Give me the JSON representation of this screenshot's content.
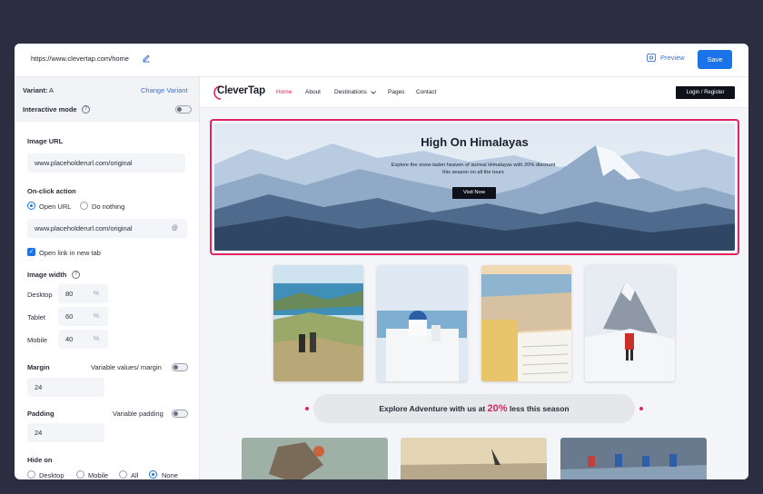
{
  "topbar": {
    "url": "https://www.clevertap.com/home",
    "preview_label": "Preview",
    "save_label": "Save"
  },
  "sidebar": {
    "variant_label": "Variant:",
    "variant_value": "A",
    "change_variant": "Change Variant",
    "interactive_mode": "Interactive mode",
    "image_url_label": "Image URL",
    "image_url_value": "www.placeholderurl.com/original",
    "onclick_label": "On-click action",
    "open_url": "Open URL",
    "do_nothing": "Do nothing",
    "onclick_url_value": "www.placeholderurl.com/original",
    "open_new_tab": "Open link in new tab",
    "image_width_label": "Image width",
    "desktop": "Desktop",
    "desktop_value": "80",
    "tablet": "Tablet",
    "tablet_value": "60",
    "mobile": "Mobile",
    "mobile_value": "40",
    "percent": "%",
    "margin_label": "Margin",
    "variable_margin": "Variable values/ margin",
    "margin_value": "24",
    "padding_label": "Padding",
    "variable_padding": "Variable padding",
    "padding_value": "24",
    "hide_on_label": "Hide on",
    "hide_options": [
      "Desktop",
      "Mobile",
      "All",
      "None"
    ],
    "hide_selected": "None"
  },
  "site": {
    "logo": "CleverTap",
    "nav": [
      "Home",
      "About",
      "Destinations",
      "Pages",
      "Contact"
    ],
    "login": "Login / Register",
    "banner_title": "High On Himalayas",
    "banner_sub": "Explore the snow-laden heaven of surreal Himalayas with 20% discount this season on all the tours",
    "banner_button": "Visit Now",
    "promo_pre": "Explore Adventure with us at ",
    "promo_highlight": "20%",
    "promo_post": " less this season"
  },
  "colors": {
    "accent": "#e0245e",
    "primary": "#1a73e8"
  }
}
